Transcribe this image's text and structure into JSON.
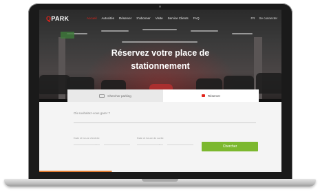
{
  "nav": {
    "logo": "PARK",
    "logo_prefix": "Q",
    "items": [
      "Accueil",
      "Autocités",
      "Réserver",
      "S'abonner",
      "Visite",
      "Service Clients",
      "FAQ"
    ],
    "lang": "FR",
    "account": "Se connecter"
  },
  "hero": {
    "headline_line1": "Réservez votre place de",
    "headline_line2": "stationnement"
  },
  "tabs": {
    "left": "Chercher parking",
    "right": "Réserver"
  },
  "form": {
    "destination_question": "Où souhaitez-vous garer ?",
    "start_label": "Date et heure d'entrée",
    "end_label": "Date et heure de sortie",
    "search_button": "Chercher"
  },
  "colors": {
    "brand_red": "#e2231a",
    "search_green": "#7cb82f"
  }
}
